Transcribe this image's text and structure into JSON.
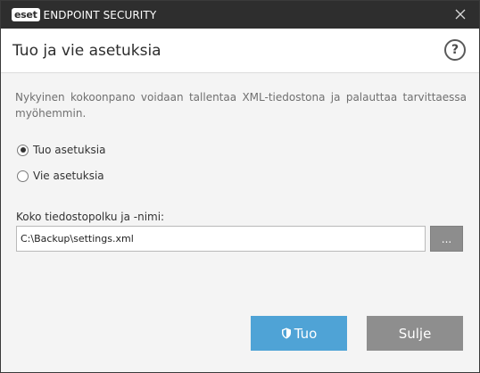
{
  "titlebar": {
    "logo_text": "eset",
    "product_name": "ENDPOINT SECURITY"
  },
  "header": {
    "title": "Tuo ja vie asetuksia",
    "help_label": "?"
  },
  "description": "Nykyinen kokoonpano voidaan tallentaa XML-tiedostona ja palauttaa tarvittaessa myöhemmin.",
  "options": {
    "import_label": "Tuo asetuksia",
    "export_label": "Vie asetuksia",
    "selected": "import"
  },
  "path": {
    "label": "Koko tiedostopolku ja -nimi:",
    "value": "C:\\Backup\\settings.xml",
    "browse_label": "..."
  },
  "buttons": {
    "primary_label": "Tuo",
    "close_label": "Sulje"
  },
  "colors": {
    "titlebar": "#2e2e2e",
    "primary": "#4fa3d6",
    "secondary": "#8e8e8e"
  }
}
